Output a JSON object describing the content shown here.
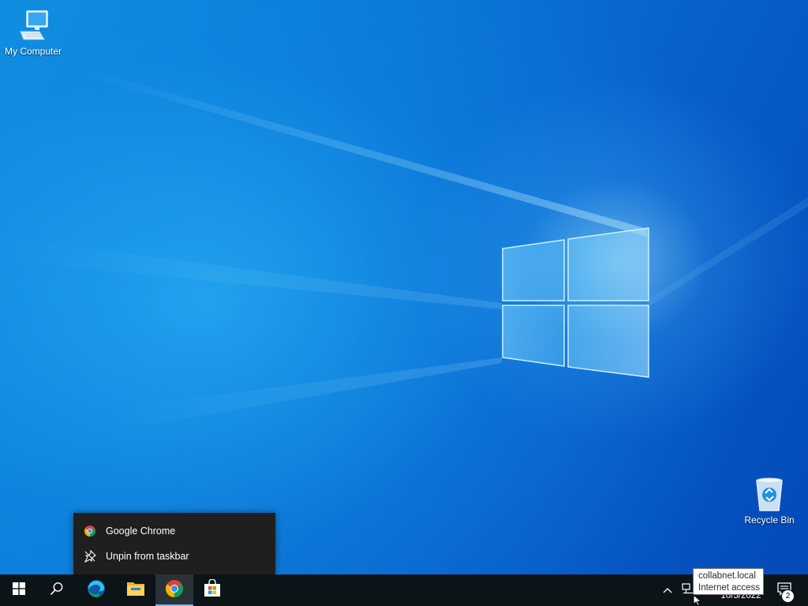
{
  "desktop": {
    "icons": [
      {
        "label": "My Computer",
        "icon": "computer-icon"
      },
      {
        "label": "Recycle Bin",
        "icon": "recycle-bin-icon"
      }
    ]
  },
  "jumplist": {
    "app_name": "Google Chrome",
    "app_icon": "chrome-icon",
    "unpin_label": "Unpin from taskbar",
    "unpin_icon": "unpin-icon"
  },
  "taskbar": {
    "start_icon": "windows-logo-icon",
    "search_icon": "search-icon",
    "pinned": [
      {
        "name": "Microsoft Edge",
        "icon": "edge-icon"
      },
      {
        "name": "File Explorer",
        "icon": "file-explorer-icon"
      },
      {
        "name": "Google Chrome",
        "icon": "chrome-icon",
        "active": true
      },
      {
        "name": "Microsoft Store",
        "icon": "store-icon"
      }
    ]
  },
  "tray": {
    "date": "10/5/2022",
    "notification_count": "2",
    "tooltip": {
      "line1": "collabnet.local",
      "line2": "Internet access"
    }
  },
  "colors": {
    "taskbar": "#0d1418",
    "accent": "#76b9ed",
    "jumplist_bg": "#1f1f1f",
    "wallpaper_blue": "#0a78d6"
  }
}
